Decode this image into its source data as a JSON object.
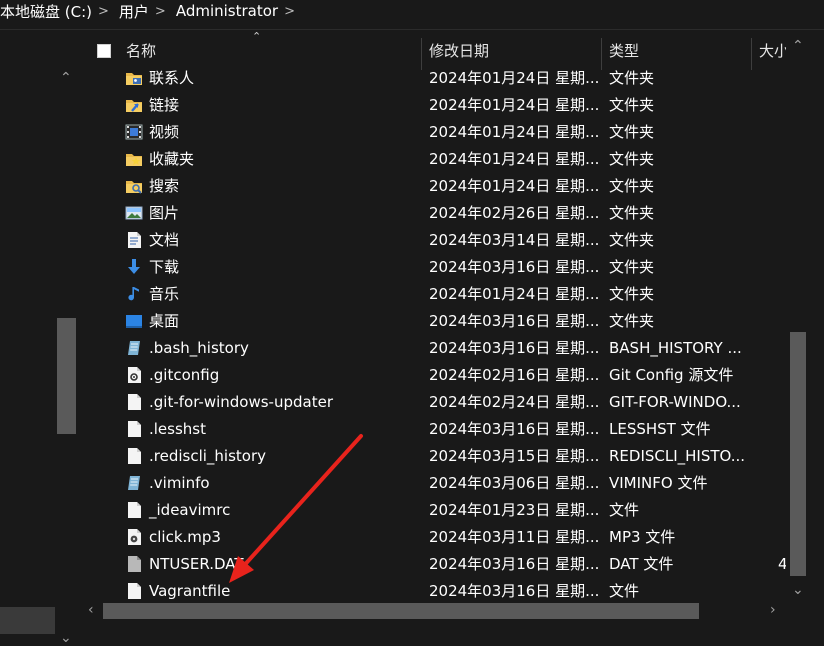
{
  "breadcrumb": {
    "items": [
      "本地磁盘 (C:)",
      "用户",
      "Administrator"
    ],
    "separator": ">"
  },
  "columns": {
    "name": "名称",
    "date": "修改日期",
    "type": "类型",
    "size": "大小"
  },
  "files": [
    {
      "name": "联系人",
      "date": "2024年01月24日 星期...",
      "type": "文件夹",
      "size": "",
      "icon": "contacts-folder-icon"
    },
    {
      "name": "链接",
      "date": "2024年01月24日 星期...",
      "type": "文件夹",
      "size": "",
      "icon": "links-folder-icon"
    },
    {
      "name": "视频",
      "date": "2024年01月24日 星期...",
      "type": "文件夹",
      "size": "",
      "icon": "videos-folder-icon"
    },
    {
      "name": "收藏夹",
      "date": "2024年01月24日 星期...",
      "type": "文件夹",
      "size": "",
      "icon": "favorites-folder-icon"
    },
    {
      "name": "搜索",
      "date": "2024年01月24日 星期...",
      "type": "文件夹",
      "size": "",
      "icon": "searches-folder-icon"
    },
    {
      "name": "图片",
      "date": "2024年02月26日 星期...",
      "type": "文件夹",
      "size": "",
      "icon": "pictures-folder-icon"
    },
    {
      "name": "文档",
      "date": "2024年03月14日 星期...",
      "type": "文件夹",
      "size": "",
      "icon": "documents-folder-icon"
    },
    {
      "name": "下载",
      "date": "2024年03月16日 星期...",
      "type": "文件夹",
      "size": "",
      "icon": "downloads-folder-icon"
    },
    {
      "name": "音乐",
      "date": "2024年01月24日 星期...",
      "type": "文件夹",
      "size": "",
      "icon": "music-folder-icon"
    },
    {
      "name": "桌面",
      "date": "2024年03月16日 星期...",
      "type": "文件夹",
      "size": "",
      "icon": "desktop-folder-icon"
    },
    {
      "name": ".bash_history",
      "date": "2024年03月16日 星期...",
      "type": "BASH_HISTORY ...",
      "size": "",
      "icon": "notepad-file-icon"
    },
    {
      "name": ".gitconfig",
      "date": "2024年02月16日 星期...",
      "type": "Git Config 源文件",
      "size": "",
      "icon": "config-file-icon"
    },
    {
      "name": ".git-for-windows-updater",
      "date": "2024年02月24日 星期...",
      "type": "GIT-FOR-WINDO...",
      "size": "",
      "icon": "blank-file-icon"
    },
    {
      "name": ".lesshst",
      "date": "2024年03月16日 星期...",
      "type": "LESSHST 文件",
      "size": "",
      "icon": "blank-file-icon"
    },
    {
      "name": ".rediscli_history",
      "date": "2024年03月15日 星期...",
      "type": "REDISCLI_HISTO...",
      "size": "",
      "icon": "blank-file-icon"
    },
    {
      "name": ".viminfo",
      "date": "2024年03月06日 星期...",
      "type": "VIMINFO 文件",
      "size": "",
      "icon": "notepad-file-icon"
    },
    {
      "name": "_ideavimrc",
      "date": "2024年01月23日 星期...",
      "type": "文件",
      "size": "",
      "icon": "blank-file-icon"
    },
    {
      "name": "click.mp3",
      "date": "2024年03月11日 星期...",
      "type": "MP3 文件",
      "size": "",
      "icon": "audio-file-icon"
    },
    {
      "name": "NTUSER.DAT",
      "date": "2024年03月16日 星期...",
      "type": "DAT 文件",
      "size": "4",
      "icon": "system-file-icon"
    },
    {
      "name": "Vagrantfile",
      "date": "2024年03月16日 星期...",
      "type": "文件",
      "size": "",
      "icon": "blank-file-icon"
    }
  ],
  "colors": {
    "background": "#191919",
    "text": "#ffffff",
    "scrollbar_thumb": "#5a5a5a",
    "annotation_arrow": "#e8231c",
    "folder": "#f2c14e"
  }
}
